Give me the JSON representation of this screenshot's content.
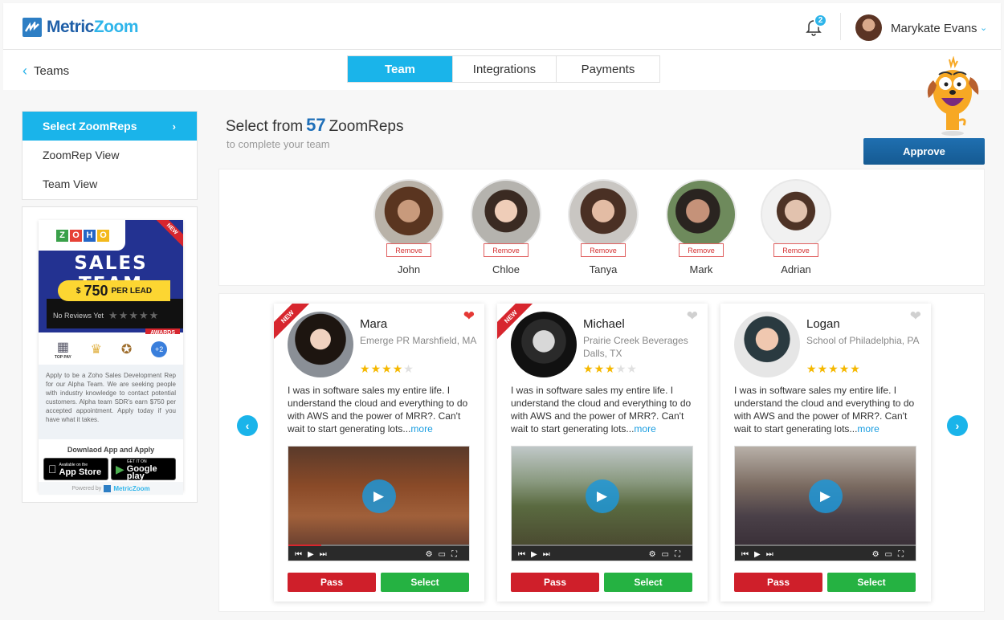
{
  "header": {
    "logo": {
      "part1": "Metric",
      "part2": "Zoom"
    },
    "notifications_count": "2",
    "user_name": "Marykate Evans"
  },
  "subnav": {
    "back_label": "Teams",
    "tabs": [
      {
        "label": "Team",
        "active": true
      },
      {
        "label": "Integrations",
        "active": false
      },
      {
        "label": "Payments",
        "active": false
      }
    ]
  },
  "sidebar": {
    "items": [
      {
        "label": "Select ZoomReps",
        "active": true
      },
      {
        "label": "ZoomRep View",
        "active": false
      },
      {
        "label": "Team View",
        "active": false
      }
    ]
  },
  "ad": {
    "brand_letters": [
      "Z",
      "O",
      "H",
      "O"
    ],
    "new_label": "NEW",
    "title": "SALES TEAM",
    "currency": "$",
    "amount": "750",
    "per_lead": "PER LEAD",
    "reviews_text": "No Reviews Yet",
    "awards_label": "AWARDS",
    "award_top_pay": "TOP PAY",
    "award_more": "+2",
    "description": "Apply to be a Zoho Sales Development Rep for our Alpha Team. We are seeking people with industry knowledge to contact potential customers. Alpha team SDR's earn $750 per accepted appointment. Apply today if you have what it takes.",
    "download_label": "Downlaod App and Apply",
    "app_store": {
      "small": "Available on the",
      "big": "App Store"
    },
    "google_play": {
      "small": "GET IT ON",
      "big": "Google play"
    },
    "powered_by": "Powered by",
    "powered_brand": "MetricZoom"
  },
  "main": {
    "heading_prefix": "Select from",
    "count": "57",
    "heading_suffix": "ZoomReps",
    "subheading": "to complete your team",
    "approve_label": "Approve",
    "remove_label": "Remove",
    "team": [
      {
        "name": "John"
      },
      {
        "name": "Chloe"
      },
      {
        "name": "Tanya"
      },
      {
        "name": "Mark"
      },
      {
        "name": "Adrian"
      }
    ],
    "candidates": [
      {
        "name": "Mara",
        "org": "Emerge PR Marshfield, MA",
        "rating": 4,
        "is_new": true,
        "favorited": true,
        "bio": "I was in software sales my entire life. I understand the cloud and everything to do with AWS and the power of MRR?. Can't wait to start generating lots...",
        "more": "more"
      },
      {
        "name": "Michael",
        "org": "Prairie Creek Beverages Dalls, TX",
        "rating": 3,
        "is_new": true,
        "favorited": false,
        "bio": "I was in software sales my entire life. I understand the cloud and everything to do with AWS and the power of MRR?. Can't wait to start generating lots...",
        "more": "more"
      },
      {
        "name": "Logan",
        "org": "School of Philadelphia, PA",
        "rating": 5,
        "is_new": false,
        "favorited": false,
        "bio": "I was in software sales my entire life. I understand the cloud and everything to do with AWS and the power of MRR?. Can't wait to start generating lots...",
        "more": "more"
      }
    ],
    "card_new_label": "NEW",
    "pass_label": "Pass",
    "select_label": "Select"
  },
  "colors": {
    "accent": "#1ab4ea",
    "brand_dark": "#1b64a2",
    "pass": "#cf1f2a",
    "select": "#25b242",
    "star": "#f5b800"
  }
}
